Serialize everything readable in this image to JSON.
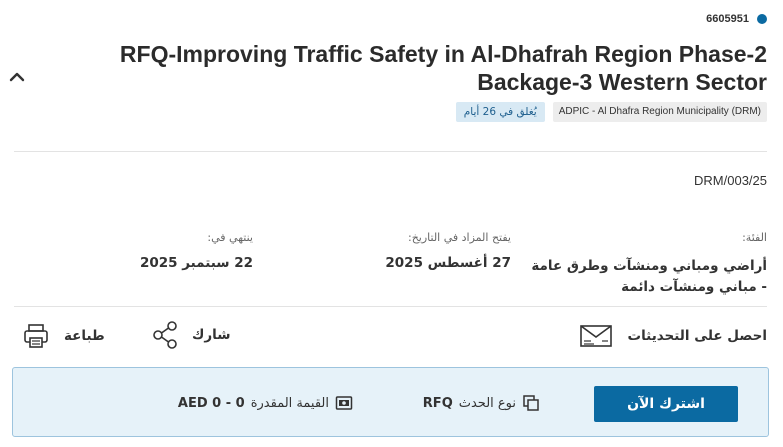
{
  "tender": {
    "id": "6605951",
    "title": "RFQ-Improving Traffic Safety in Al-Dhafrah Region Phase-2 Backage-3 Western Sector",
    "organization": "ADPIC - Al Dhafra Region Municipality (DRM)",
    "closing_badge": "يُغلق في 26 أيام",
    "reference": "DRM/003/25"
  },
  "details": {
    "category_label": "الفئة:",
    "category_value": "أراضي ومباني ومنشآت وطرق عامة - مباني ومنشآت دائمة",
    "opens_label": "يفتح المزاد في التاريخ:",
    "opens_value": "27 أغسطس 2025",
    "ends_label": "ينتهي في:",
    "ends_value": "22 سبتمبر 2025"
  },
  "actions": {
    "updates_label": "احصل على التحديثات",
    "share_label": "شارك",
    "print_label": "طباعة"
  },
  "panel": {
    "subscribe_label": "اشترك الآن",
    "event_type_label": "نوع الحدث",
    "event_type_value": "RFQ",
    "estimated_value_label": "القيمة المقدرة",
    "estimated_value_value": "AED 0 - 0"
  },
  "colors": {
    "accent": "#0b6aa2",
    "panel_background": "#e6f2f9",
    "badge_background": "#d8e9f4"
  },
  "icons": [
    "status-dot-icon",
    "chevron-up-icon",
    "envelope-newsletter-icon",
    "share-icon",
    "printer-icon",
    "event-type-icon",
    "money-icon"
  ]
}
